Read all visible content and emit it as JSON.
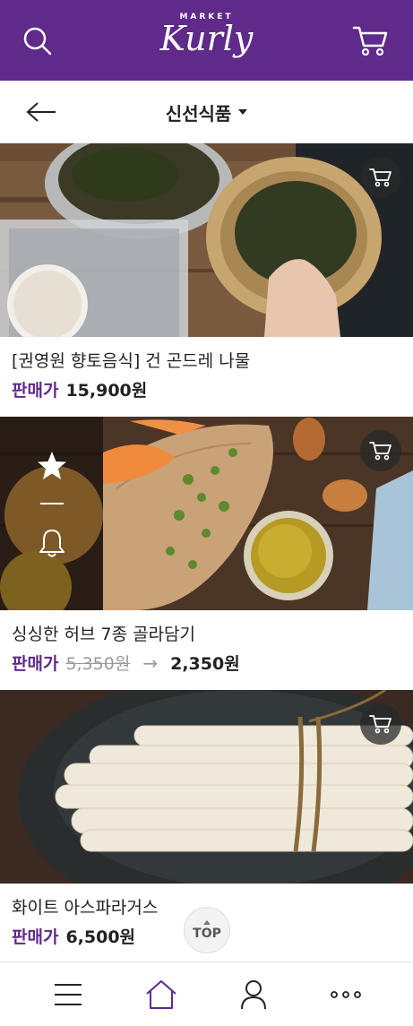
{
  "app": {
    "logo_small": "MARKET",
    "logo_big": "Kurly"
  },
  "header": {
    "category_title": "신선식품"
  },
  "products": [
    {
      "name": "[권영원 향토음식] 건 곤드레 나물",
      "price_label": "판매가",
      "price": "15,900원",
      "original_price": null
    },
    {
      "name": "싱싱한 허브 7종 골라담기",
      "price_label": "판매가",
      "original_price": "5,350원",
      "arrow": "→",
      "price": "2,350원"
    },
    {
      "name": "화이트 아스파라거스",
      "price_label": "판매가",
      "price": "6,500원",
      "original_price": null
    }
  ],
  "top_button": {
    "label": "TOP"
  },
  "icons": {
    "search": "search-icon",
    "cart": "cart-icon",
    "back": "arrow-left-icon",
    "star": "star-icon",
    "bell": "bell-icon",
    "menu": "menu-icon",
    "home": "home-icon",
    "user": "user-icon",
    "more": "more-icon"
  },
  "colors": {
    "brand": "#5f2a8a",
    "nav_active": "#5f2a8a"
  }
}
